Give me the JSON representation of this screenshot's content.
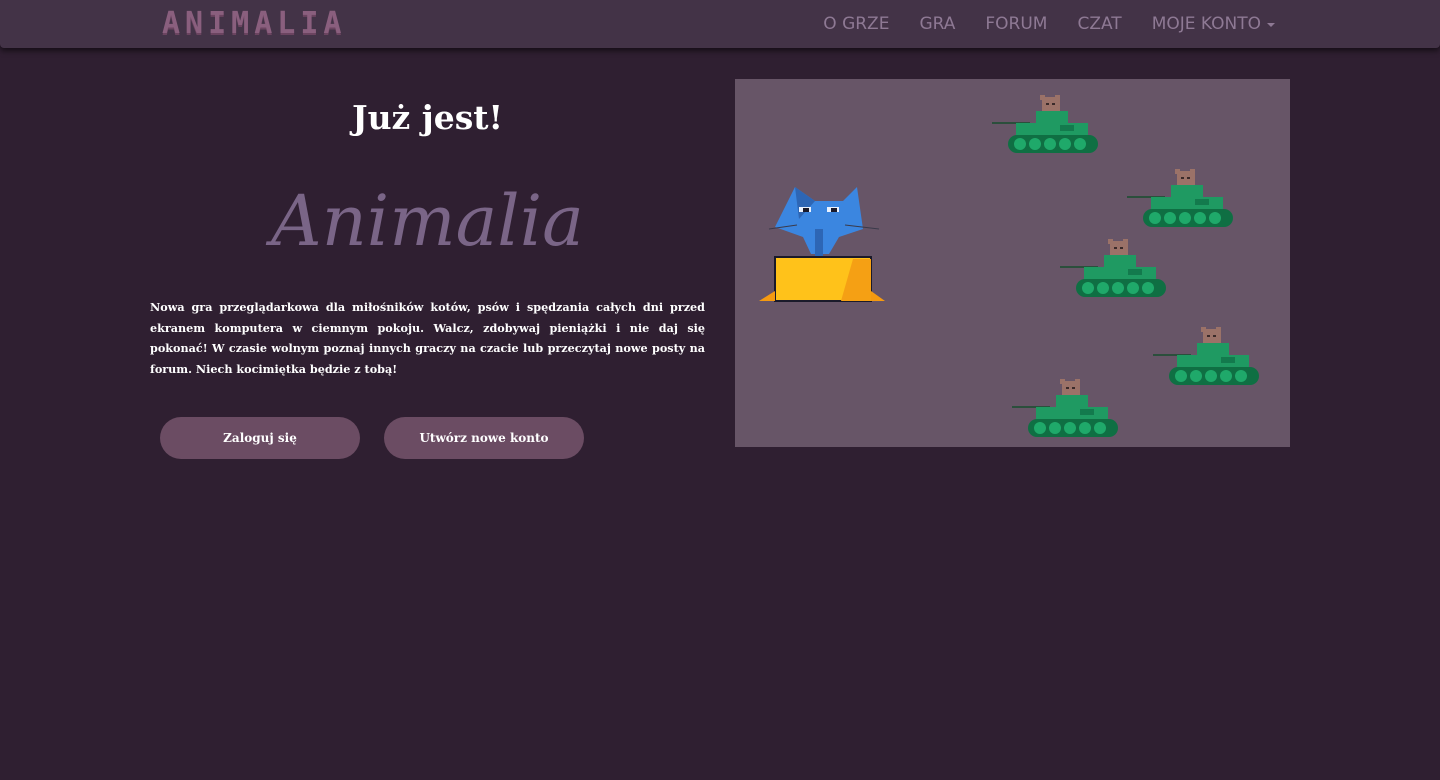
{
  "nav": {
    "brand": "ANIMALIA",
    "links": [
      "O GRZE",
      "GRA",
      "FORUM",
      "CZAT"
    ],
    "account": "MOJE KONTO"
  },
  "hero": {
    "headline": "Już jest!",
    "title": "Animalia",
    "description": "Nowa gra przeglądarkowa dla miłośników kotów, psów i spędzania całych dni przed ekranem komputera w ciemnym pokoju. Walcz, zdobywaj pieniążki i nie daj się pokonać! W czasie wolnym poznaj innych graczy na czacie lub przeczytaj nowe posty na forum. Niech kocimiętka będzie z tobą!",
    "login_label": "Zaloguj się",
    "register_label": "Utwórz nowe konto"
  },
  "illustration": {
    "icon": "cat-vs-tanks-illustration",
    "colors": {
      "background": "#675567",
      "cat": "#3b86e0",
      "box": "#ffc21a",
      "tank": "#1f9a62"
    }
  },
  "theme": {
    "page_bg": "#2f1f31",
    "navbar_bg": "#433347",
    "button_bg": "#6b4c63",
    "title_color": "#7a6587"
  }
}
